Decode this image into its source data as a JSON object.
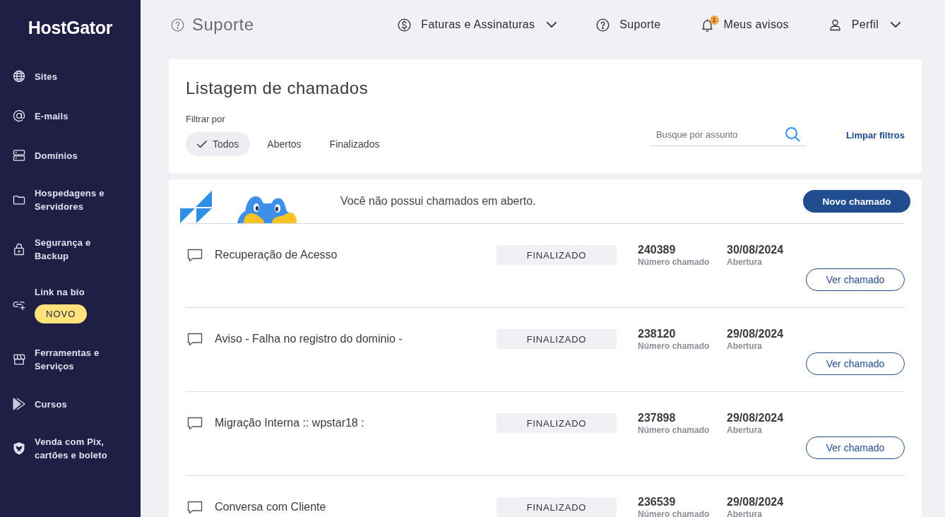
{
  "sidebar": {
    "logo": "HostGator",
    "items": [
      {
        "label": "Sites"
      },
      {
        "label": "E-mails"
      },
      {
        "label": "Domínios"
      },
      {
        "label": "Hospedagens e Servidores"
      },
      {
        "label": "Segurança e Backup"
      },
      {
        "label": "Link na bio",
        "badge": "NOVO"
      },
      {
        "label": "Ferramentas e Serviços"
      },
      {
        "label": "Cursos"
      },
      {
        "label": "Venda com Pix, cartões e boleto"
      }
    ]
  },
  "header": {
    "title": "Suporte",
    "nav": [
      {
        "label": "Faturas e Assinaturas",
        "dropdown": true
      },
      {
        "label": "Suporte",
        "dropdown": false
      },
      {
        "label": "Meus avisos",
        "dropdown": false,
        "count": "1"
      },
      {
        "label": "Perfil",
        "dropdown": true
      }
    ]
  },
  "tickets_panel": {
    "title": "Listagem de chamados",
    "filter_label": "Filtrar por",
    "filters": [
      {
        "label": "Todos",
        "selected": true
      },
      {
        "label": "Abertos",
        "selected": false
      },
      {
        "label": "Finalizados",
        "selected": false
      }
    ],
    "search": {
      "placeholder": "Busque por assunto"
    },
    "clear_filters": "Limpar filtros"
  },
  "tickets": {
    "empty_message": "Você não possui chamados em aberto.",
    "new_button": "Novo chamado",
    "rows": [
      {
        "subject": "Recuperação de Acesso",
        "status": "FINALIZADO",
        "number": "240389",
        "number_label": "Número chamado",
        "date": "30/08/2024",
        "date_label": "Abertura",
        "action": "Ver chamado"
      },
      {
        "subject": "Aviso - Falha no registro do dominio -",
        "status": "FINALIZADO",
        "number": "238120",
        "number_label": "Número chamado",
        "date": "29/08/2024",
        "date_label": "Abertura",
        "action": "Ver chamado"
      },
      {
        "subject": "Migração Interna :: wpstar18 :",
        "status": "FINALIZADO",
        "number": "237898",
        "number_label": "Número chamado",
        "date": "29/08/2024",
        "date_label": "Abertura",
        "action": "Ver chamado"
      },
      {
        "subject": "Conversa com Cliente",
        "status": "FINALIZADO",
        "number": "236539",
        "number_label": "Número chamado",
        "date": "29/08/2024",
        "date_label": "Abertura"
      }
    ]
  }
}
